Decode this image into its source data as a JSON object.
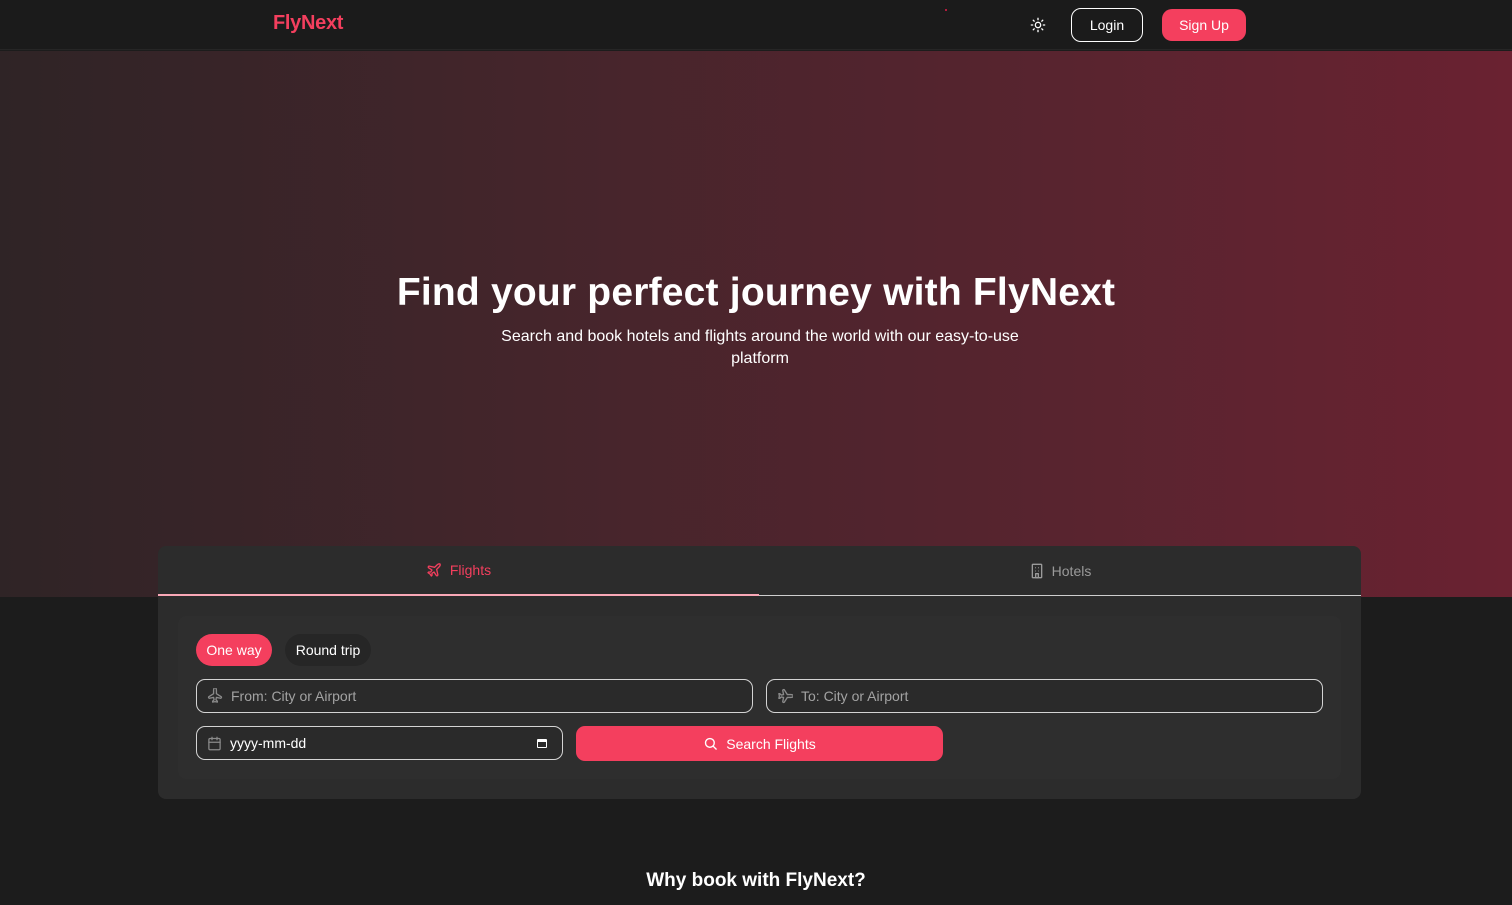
{
  "navbar": {
    "brand": "FlyNext",
    "theme_icon": "sun-icon",
    "login_label": "Login",
    "signup_label": "Sign Up"
  },
  "hero": {
    "title": "Find your perfect journey with FlyNext",
    "subtitle": "Search and book hotels and flights around the world with our easy-to-use platform"
  },
  "search": {
    "tabs": [
      {
        "label": "Flights",
        "icon": "plane-icon",
        "active": true
      },
      {
        "label": "Hotels",
        "icon": "building-icon",
        "active": false
      }
    ],
    "trip_types": [
      {
        "label": "One way",
        "selected": true
      },
      {
        "label": "Round trip",
        "selected": false
      }
    ],
    "from_placeholder": "From: City or Airport",
    "to_placeholder": "To: City or Airport",
    "date_value": "yyyy-mm-dd",
    "search_label": "Search Flights"
  },
  "section": {
    "why_title": "Why book with FlyNext?"
  },
  "colors": {
    "accent": "#f43f5e",
    "background": "#1c1c1c",
    "card": "#2c2c2c"
  }
}
